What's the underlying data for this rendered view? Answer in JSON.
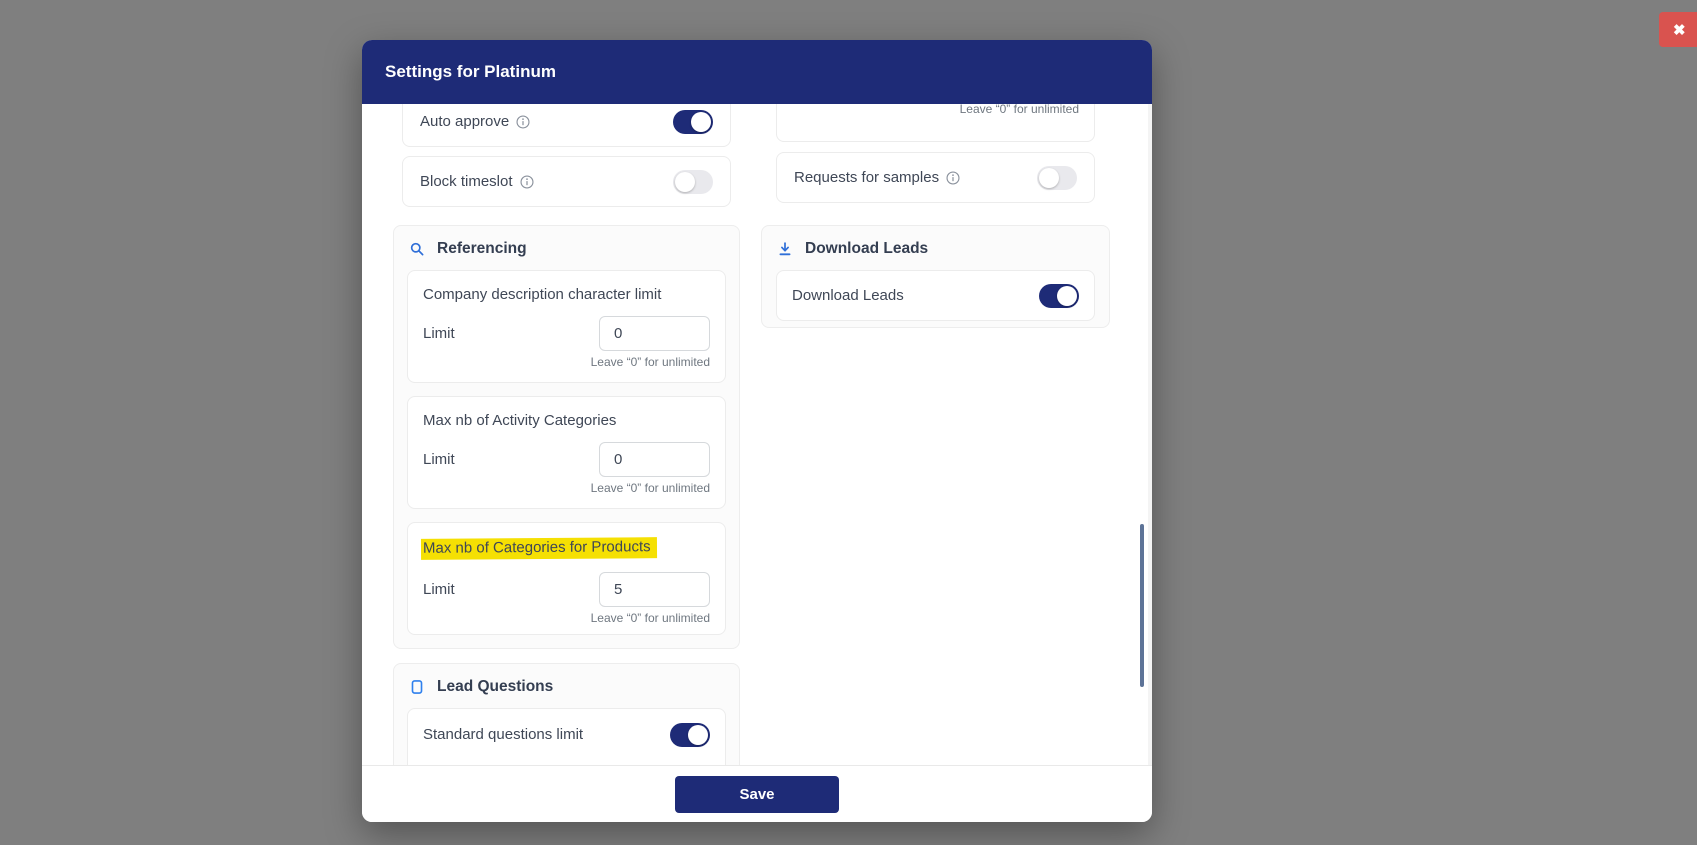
{
  "close_button": {
    "glyph": "✖"
  },
  "modal": {
    "title": "Settings for Platinum",
    "save_label": "Save"
  },
  "left_column": {
    "toggle_cards": [
      {
        "label": "Auto approve",
        "state": "on"
      },
      {
        "label": "Block timeslot",
        "state": "off"
      }
    ],
    "referencing": {
      "title": "Referencing",
      "icon": "search-icon",
      "limit_cards": [
        {
          "title": "Company description character limit",
          "field_label": "Limit",
          "value": "0",
          "helper": "Leave “0” for unlimited",
          "highlighted": false
        },
        {
          "title": "Max nb of Activity Categories",
          "field_label": "Limit",
          "value": "0",
          "helper": "Leave “0” for unlimited",
          "highlighted": false
        },
        {
          "title": "Max nb of Categories for Products",
          "field_label": "Limit",
          "value": "5",
          "helper": "Leave “0” for unlimited",
          "highlighted": true
        }
      ]
    },
    "lead_questions": {
      "title": "Lead Questions",
      "icon": "mobile-icon",
      "toggle": {
        "label": "Standard questions limit",
        "state": "on"
      }
    }
  },
  "right_column": {
    "partial_card": {
      "helper": "Leave “0” for unlimited"
    },
    "requests_for_samples": {
      "label": "Requests for samples",
      "state": "off"
    },
    "download_leads": {
      "title": "Download Leads",
      "icon": "download-icon",
      "toggle": {
        "label": "Download Leads",
        "state": "on"
      }
    }
  },
  "colors": {
    "accent_navy": "#1e2b77",
    "backdrop_gray": "#7f7f7f",
    "danger_red": "#d9534f",
    "icon_blue": "#2f6fd8",
    "highlight_yellow": "#f5e003",
    "scroll_thumb": "#5d7397"
  }
}
